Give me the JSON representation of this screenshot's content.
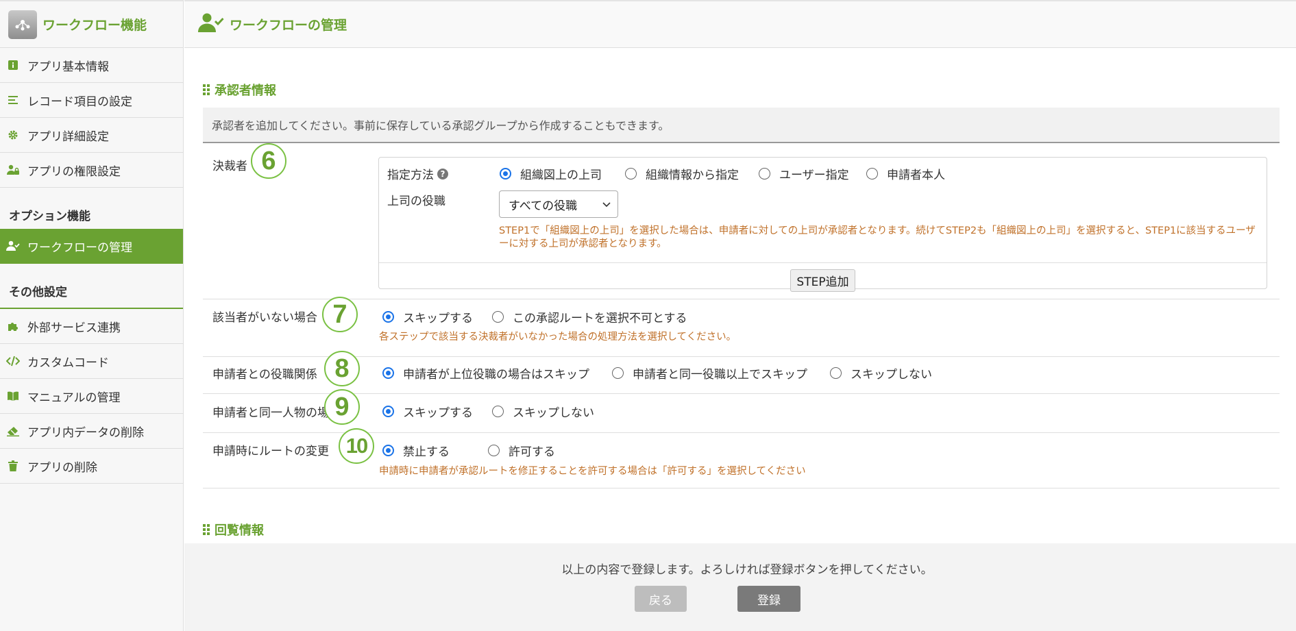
{
  "sidebar": {
    "title": "ワークフロー機能",
    "items": [
      {
        "label": "アプリ基本情報",
        "icon": "info-icon"
      },
      {
        "label": "レコード項目の設定",
        "icon": "list-icon"
      },
      {
        "label": "アプリ詳細設定",
        "icon": "gear-icon"
      },
      {
        "label": "アプリの権限設定",
        "icon": "user-lock-icon"
      }
    ],
    "option_section": "オプション機能",
    "option_items": [
      {
        "label": "ワークフローの管理",
        "icon": "user-check-icon",
        "active": true
      }
    ],
    "other_section": "その他設定",
    "other_items": [
      {
        "label": "外部サービス連携",
        "icon": "puzzle-icon"
      },
      {
        "label": "カスタムコード",
        "icon": "code-icon"
      },
      {
        "label": "マニュアルの管理",
        "icon": "book-icon"
      },
      {
        "label": "アプリ内データの削除",
        "icon": "eraser-icon"
      },
      {
        "label": "アプリの削除",
        "icon": "trash-icon"
      }
    ]
  },
  "header": {
    "title": "ワークフローの管理"
  },
  "approver": {
    "section_title": "承認者情報",
    "notice": "承認者を追加してください。事前に保存している承認グループから作成することもできます。",
    "decider": {
      "label": "決裁者",
      "badge": "6",
      "method_label": "指定方法",
      "method_options": [
        "組織図上の上司",
        "組織情報から指定",
        "ユーザー指定",
        "申請者本人"
      ],
      "method_selected": 0,
      "role_label": "上司の役職",
      "role_value": "すべての役職",
      "note": "STEP1で「組織図上の上司」を選択した場合は、申請者に対しての上司が承認者となります。続けてSTEP2も「組織図上の上司」を選択すると、STEP1に該当するユーザーに対する上司が承認者となります。",
      "step_add": "STEP追加"
    },
    "no_match": {
      "label": "該当者がいない場合",
      "badge": "7",
      "options": [
        "スキップする",
        "この承認ルートを選択不可とする"
      ],
      "selected": 0,
      "note": "各ステップで該当する決裁者がいなかった場合の処理方法を選択してください。"
    },
    "role_relation": {
      "label": "申請者との役職関係",
      "badge": "8",
      "options": [
        "申請者が上位役職の場合はスキップ",
        "申請者と同一役職以上でスキップ",
        "スキップしない"
      ],
      "selected": 0
    },
    "same_person": {
      "label": "申請者と同一人物の場合",
      "badge": "9",
      "options": [
        "スキップする",
        "スキップしない"
      ],
      "selected": 0
    },
    "route_change": {
      "label": "申請時にルートの変更",
      "badge": "10",
      "options": [
        "禁止する",
        "許可する"
      ],
      "selected": 0,
      "note": "申請時に申請者が承認ルートを修正することを許可する場合は「許可する」を選択してください"
    }
  },
  "circulation": {
    "section_title": "回覧情報"
  },
  "footer": {
    "message": "以上の内容で登録します。よろしければ登録ボタンを押してください。",
    "back": "戻る",
    "submit": "登録"
  }
}
